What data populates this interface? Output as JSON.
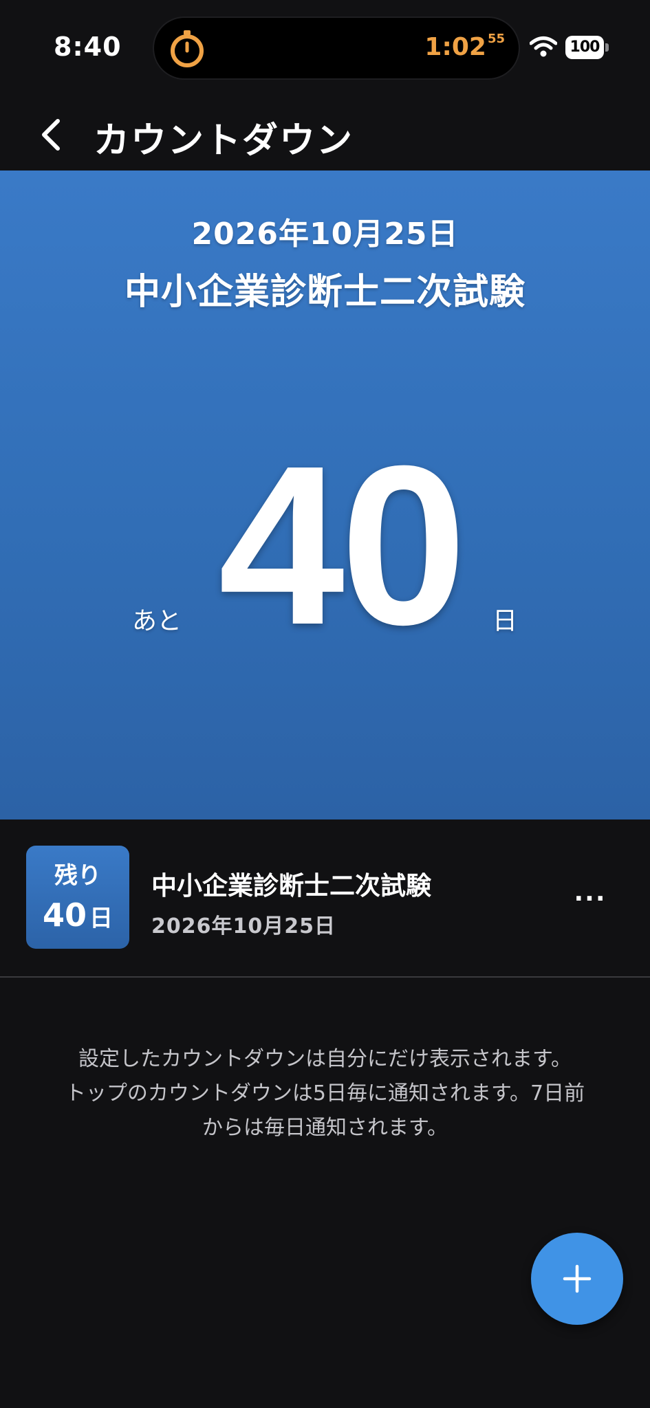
{
  "status_bar": {
    "time": "8:40",
    "timer_main": "1:02",
    "timer_seconds": "55",
    "battery": "100",
    "timer_icon": "stopwatch-icon",
    "wifi_icon": "wifi-icon"
  },
  "nav": {
    "back_icon": "chevron-left-icon",
    "title": "カウントダウン"
  },
  "hero": {
    "date": "2026年10月25日",
    "title": "中小企業診断士二次試験",
    "prefix": "あと",
    "days": "40",
    "unit": "日"
  },
  "countdown_item": {
    "badge_label": "残り",
    "badge_days": "40",
    "badge_unit": "日",
    "title": "中小企業診断士二次試験",
    "date": "2026年10月25日",
    "more_label": "..."
  },
  "info": {
    "lines": [
      "設定したカウントダウンは自分にだけ表示されます。",
      "トップのカウントダウンは5日毎に通知されます。7日前",
      "からは毎日通知されます。"
    ]
  },
  "fab": {
    "icon": "plus-icon"
  },
  "colors": {
    "background": "#111113",
    "hero_gradient_top": "#3a7ac7",
    "hero_gradient_bottom": "#2c62a6",
    "timer_accent": "#f0a245",
    "fab": "#4093e6",
    "secondary_text": "#c5c5ca"
  }
}
